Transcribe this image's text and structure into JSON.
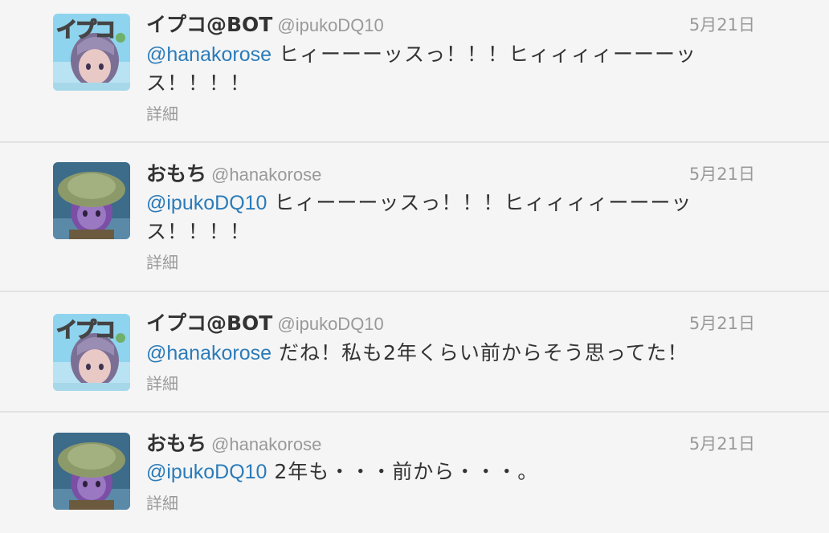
{
  "tweets": [
    {
      "name": "イプコ@BOT",
      "handle": "@ipukoDQ10",
      "date": "5月21日",
      "mention": "@hanakorose",
      "text": " ヒィーーーッスっ！！！ヒィィィィーーーッス！！！！",
      "details": "詳細",
      "avatar": "ipuko-avatar"
    },
    {
      "name": "おもち",
      "handle": "@hanakorose",
      "date": "5月21日",
      "mention": "@ipukoDQ10",
      "text": " ヒィーーーッスっ！！！ヒィィィィーーーッス！！！！",
      "details": "詳細",
      "avatar": "omochi-avatar"
    },
    {
      "name": "イプコ@BOT",
      "handle": "@ipukoDQ10",
      "date": "5月21日",
      "mention": "@hanakorose",
      "text": " だね！私も2年くらい前からそう思ってた！",
      "details": "詳細",
      "avatar": "ipuko-avatar"
    },
    {
      "name": "おもち",
      "handle": "@hanakorose",
      "date": "5月21日",
      "mention": "@ipukoDQ10",
      "text": " 2年も・・・前から・・・。",
      "details": "詳細",
      "avatar": "omochi-avatar"
    }
  ],
  "avatar_text": "イプコ",
  "colors": {
    "background": "#f5f5f5",
    "divider": "#e2e2e2",
    "mention": "#2b7bb9",
    "muted": "#999999",
    "text": "#333333"
  }
}
